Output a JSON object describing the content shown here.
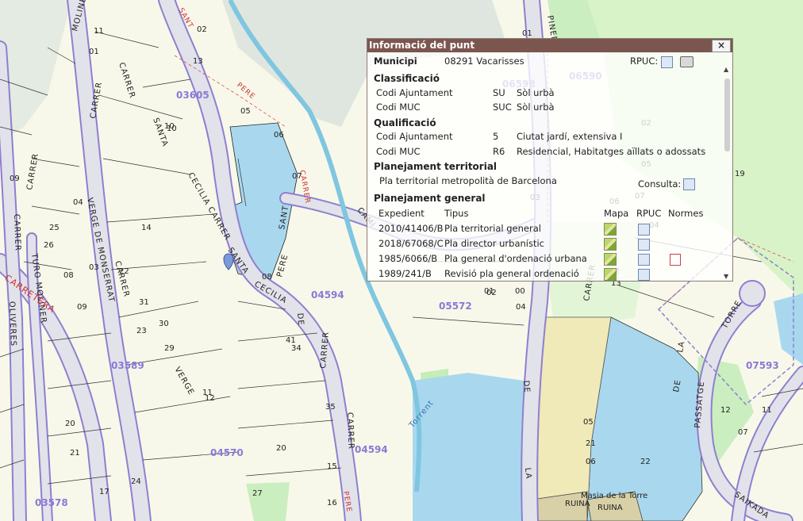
{
  "popup": {
    "title": "Informació del punt",
    "close": "×",
    "municipi_label": "Municipi",
    "municipi_value": "08291 Vacarisses",
    "rpuc_label": "RPUC:",
    "classificacio": {
      "title": "Classificació",
      "rows": [
        {
          "label": "Codi Ajuntament",
          "code": "SU",
          "desc": "Sòl urbà"
        },
        {
          "label": "Codi MUC",
          "code": "SUC",
          "desc": "Sòl urbà"
        }
      ]
    },
    "qualificacio": {
      "title": "Qualificació",
      "rows": [
        {
          "label": "Codi Ajuntament",
          "code": "5",
          "desc": "Ciutat jardí, extensiva I"
        },
        {
          "label": "Codi MUC",
          "code": "R6",
          "desc": "Residencial, Habitatges aïllats o adossats"
        }
      ]
    },
    "territorial": {
      "title": "Planejament territorial",
      "value": "Pla territorial metropolità de Barcelona",
      "consulta": "Consulta:"
    },
    "general": {
      "title": "Planejament general",
      "headers": [
        "Expedient",
        "Tipus",
        "Mapa",
        "RPUC",
        "Normes"
      ],
      "rows": [
        {
          "expedient": "2010/41406/B",
          "tipus": "Pla territorial general"
        },
        {
          "expedient": "2018/67068/C",
          "tipus": "Pla director urbanístic"
        },
        {
          "expedient": "1985/6066/B",
          "tipus": "Pla general d'ordenació urbana"
        },
        {
          "expedient": "1989/241/B",
          "tipus": "Revisió pla general ordenació"
        }
      ]
    }
  },
  "map": {
    "sectors": [
      "03605",
      "04594",
      "05572",
      "03589",
      "04570",
      "04594",
      "03578",
      "07593",
      "06598",
      "06590"
    ],
    "streets": [
      "CARRER",
      "MOLINER",
      "CARRER",
      "VERGE DE MONSERRAT",
      "CARRER",
      "SANTA",
      "CECILIA CARRER",
      "SANTA",
      "CECILIA",
      "SANT",
      "PERE",
      "CARRER",
      "SANT",
      "PERE",
      "CARRER",
      "PINEDA",
      "CARRER",
      "DE",
      "LA",
      "TORRE",
      "PASSATGE",
      "DE",
      "LA",
      "SAIKADA",
      "VERGE",
      "TURO MOLINER",
      "OLIVERES",
      "CARRER",
      "CAMI",
      "DE",
      "CARRER",
      "CARRER",
      "PERE",
      "Torrent"
    ],
    "road_label": "CARRETERA",
    "place": [
      "Masia de la Torre",
      "RUINA",
      "RUINA"
    ],
    "parcels": [
      "11",
      "01",
      "02",
      "13",
      "10",
      "05",
      "06",
      "07",
      "04",
      "03",
      "09",
      "08",
      "14",
      "31",
      "30",
      "29",
      "23",
      "26",
      "12",
      "22",
      "25",
      "35",
      "41",
      "34",
      "15",
      "16",
      "17",
      "20",
      "21",
      "24",
      "27",
      "01",
      "02",
      "04",
      "05",
      "06",
      "07",
      "11",
      "12",
      "13",
      "19",
      "21",
      "22",
      "20",
      "00",
      "01",
      "02",
      "03",
      "04",
      "05",
      "06",
      "07",
      "08",
      "09",
      "10",
      "11",
      "12"
    ]
  }
}
